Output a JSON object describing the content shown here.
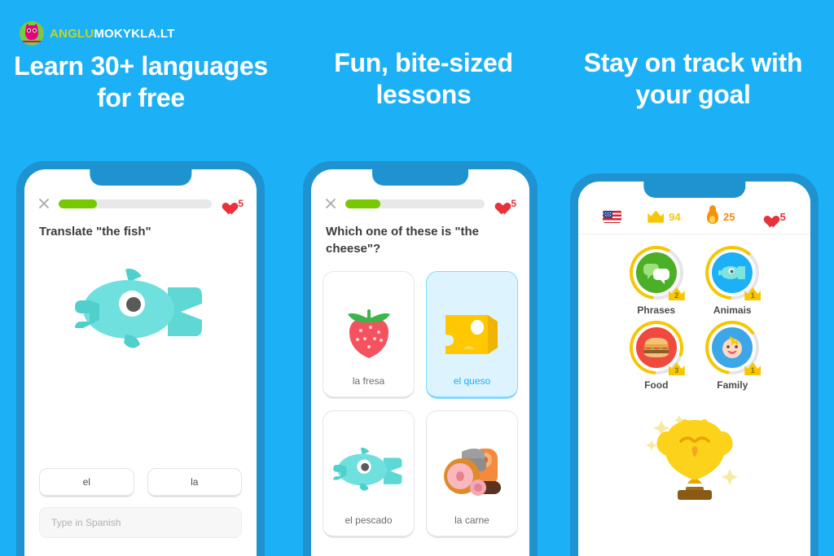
{
  "brand": {
    "logo_icon": "owl-icon",
    "name_part1": "ANGLU",
    "name_part2": "MOKYKLA.LT",
    "color_green": "#b9d831",
    "color_white": "#ffffff"
  },
  "theme": {
    "background": "#1cb0f6",
    "phone_frame": "#1e93cf",
    "progress_green": "#78c800",
    "heart_red": "#e8313b",
    "crown_gold": "#f6c700",
    "flame_orange": "#f5920b",
    "selected_blue": "#1cb0f6",
    "selected_card_bg": "#ddf4ff"
  },
  "headlines": [
    "Learn 30+ languages for free",
    "Fun, bite-sized lessons",
    "Stay on track with your goal"
  ],
  "phone1": {
    "close_icon": "close-icon",
    "progress_percent": 25,
    "hearts_icon": "heart-icon",
    "hearts_count": "5",
    "prompt": "Translate \"the fish\"",
    "illustration": "fish-illustration",
    "word_buttons": [
      "el",
      "la"
    ],
    "input_placeholder": "Type in Spanish",
    "input_value": ""
  },
  "phone2": {
    "close_icon": "close-icon",
    "progress_percent": 25,
    "hearts_icon": "heart-icon",
    "hearts_count": "5",
    "prompt": "Which one of these is \"the cheese\"?",
    "cards": [
      {
        "label": "la fresa",
        "icon": "strawberry-illustration",
        "selected": false
      },
      {
        "label": "el queso",
        "icon": "cheese-illustration",
        "selected": true
      },
      {
        "label": "el pescado",
        "icon": "fish-illustration",
        "selected": false
      },
      {
        "label": "la carne",
        "icon": "meat-illustration",
        "selected": false
      }
    ]
  },
  "phone3": {
    "stats": {
      "flag_icon": "us-flag-icon",
      "crown_icon": "crown-icon",
      "crown_count": "94",
      "flame_icon": "flame-icon",
      "flame_count": "25",
      "heart_icon": "heart-icon",
      "heart_count": "5"
    },
    "skills": [
      {
        "label": "Phrases",
        "icon": "speech-bubbles-icon",
        "level": "2",
        "disc_color": "#4caf28",
        "progress": 55
      },
      {
        "label": "Animais",
        "icon": "fish-icon",
        "level": "1",
        "disc_color": "#1cb0f6",
        "progress": 60
      },
      {
        "label": "Food",
        "icon": "burger-icon",
        "level": "3",
        "disc_color": "#f04a3f",
        "progress": 78
      },
      {
        "label": "Family",
        "icon": "baby-face-icon",
        "level": "1",
        "disc_color": "#3ba6e8",
        "progress": 62
      }
    ],
    "trophy_icon": "golden-owl-trophy-icon"
  }
}
